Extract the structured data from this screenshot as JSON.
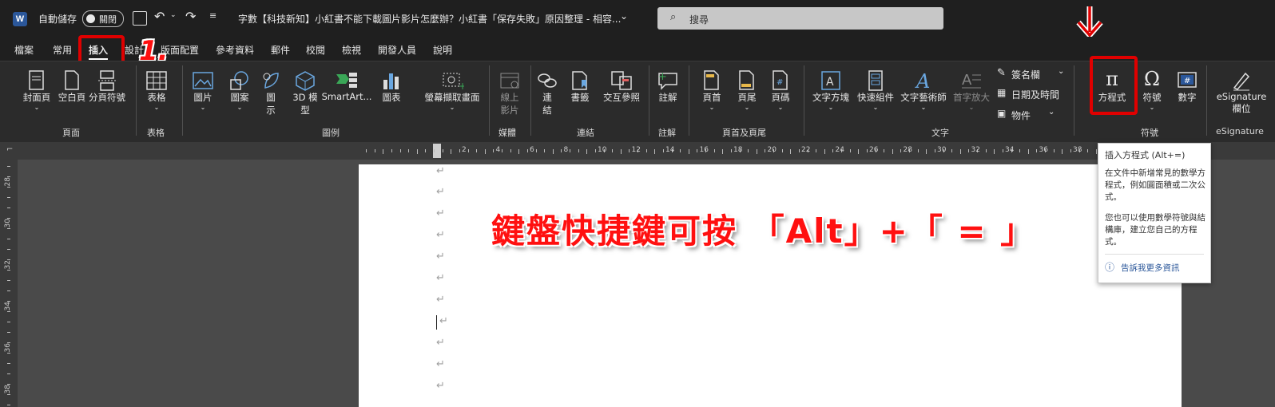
{
  "title_bar": {
    "autosave_label": "自動儲存",
    "autosave_state": "關閉",
    "doc_title": "字數【科技新知】小紅書不能下載圖片影片怎麼辦？小紅書「保存失敗」原因整理 - 相容...",
    "search_placeholder": "搜尋"
  },
  "tabs": [
    "檔案",
    "常用",
    "插入",
    "設計",
    "版面配置",
    "參考資料",
    "郵件",
    "校閱",
    "檢視",
    "開發人員",
    "說明"
  ],
  "ribbon": {
    "groups": {
      "pages": "頁面",
      "tables": "表格",
      "illustrations": "圖例",
      "media": "媒體",
      "links": "連結",
      "comments": "註解",
      "header_footer": "頁首及頁尾",
      "text": "文字",
      "symbols": "符號",
      "esignature": "eSignature"
    },
    "buttons": {
      "cover_page": "封面頁",
      "blank_page": "空白頁",
      "page_break": "分頁符號",
      "table": "表格",
      "pictures": "圖片",
      "shapes": "圖案",
      "icons_1": "圖",
      "icons_2": "示",
      "models_1": "3D 模",
      "models_2": "型",
      "smartart": "SmartArt...",
      "chart": "圖表",
      "screenshot": "螢幕擷取畫面",
      "online_video_1": "線上",
      "online_video_2": "影片",
      "link_1": "連",
      "link_2": "結",
      "bookmark": "書籤",
      "cross_ref": "交互參照",
      "comment": "註解",
      "header": "頁首",
      "footer": "頁尾",
      "page_number": "頁碼",
      "textbox": "文字方塊",
      "quick_parts": "快速組件",
      "wordart": "文字藝術師",
      "dropcap": "首字放大",
      "signature_line": "簽名欄",
      "date_time": "日期及時間",
      "object": "物件",
      "equation": "方程式",
      "symbol": "符號",
      "number": "數字",
      "esign_1": "eSignature",
      "esign_2": "欄位"
    }
  },
  "tooltip": {
    "title": "插入方程式 (Alt+=)",
    "body1": "在文件中新增常見的數學方程式，例如圓面積或二次公式。",
    "body2": "您也可以使用數學符號與結構庫，建立您自己的方程式。",
    "link": "告訴我更多資訊"
  },
  "ruler_ticks": [
    "2",
    "4",
    "6",
    "8",
    "10",
    "12",
    "14",
    "16",
    "18",
    "20",
    "22",
    "24",
    "26",
    "28",
    "30",
    "32",
    "34",
    "36",
    "38",
    "40"
  ],
  "left_ruler_ticks": [
    "28",
    "30",
    "32",
    "34",
    "36",
    "38"
  ],
  "annotations": {
    "step_number": "1.",
    "main_text": "鍵盤快捷鍵可按 「Alt」+「 = 」"
  },
  "colors": {
    "accent_red": "#e00000",
    "word_blue": "#2b579a"
  }
}
